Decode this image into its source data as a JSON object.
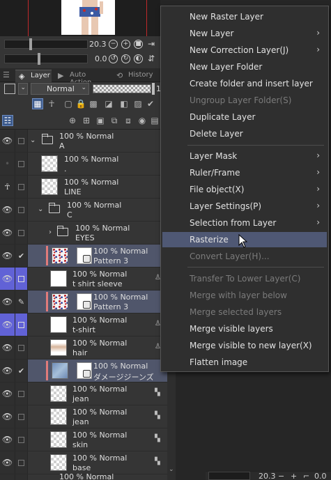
{
  "navigator": {
    "zoom_value": "20.3",
    "rotation_value": "0.0"
  },
  "tabs": [
    {
      "label": "Layer",
      "icon": "layers-icon",
      "active": true
    },
    {
      "label": "Auto Action",
      "icon": "auto-action-icon",
      "active": false
    },
    {
      "label": "History",
      "icon": "history-icon",
      "active": false
    }
  ],
  "blend_mode": {
    "selected": "Normal"
  },
  "opacity_value": "10",
  "layers": [
    {
      "pct": "100 %",
      "mode": "Normal",
      "name": "A",
      "type": "folder",
      "expanded": true,
      "indent": 0
    },
    {
      "pct": "100 %",
      "mode": "Normal",
      "name": ".",
      "type": "raster",
      "indent": 1
    },
    {
      "pct": "100 %",
      "mode": "Normal",
      "name": "LINE",
      "type": "raster",
      "indent": 1
    },
    {
      "pct": "100 %",
      "mode": "Normal",
      "name": "C",
      "type": "folder",
      "expanded": true,
      "indent": 1
    },
    {
      "pct": "100 %",
      "mode": "Normal",
      "name": "EYES",
      "type": "folder",
      "expanded": false,
      "indent": 2
    },
    {
      "pct": "100 %",
      "mode": "Normal",
      "name": "Pattern 3",
      "type": "pattern",
      "indent": 2
    },
    {
      "pct": "100 %",
      "mode": "Normal",
      "name": "t shirt sleeve",
      "type": "raster",
      "indent": 2
    },
    {
      "pct": "100 %",
      "mode": "Normal",
      "name": "Pattern 3",
      "type": "pattern",
      "indent": 2
    },
    {
      "pct": "100 %",
      "mode": "Normal",
      "name": "t-shirt",
      "type": "raster",
      "indent": 2
    },
    {
      "pct": "100 %",
      "mode": "Normal",
      "name": "hair",
      "type": "raster",
      "indent": 2
    },
    {
      "pct": "100 %",
      "mode": "Normal",
      "name": "ダメージジーンズ",
      "type": "denim",
      "indent": 2
    },
    {
      "pct": "100 %",
      "mode": "Normal",
      "name": "jean",
      "type": "raster",
      "indent": 2
    },
    {
      "pct": "100 %",
      "mode": "Normal",
      "name": "jean",
      "type": "raster",
      "indent": 2
    },
    {
      "pct": "100 %",
      "mode": "Normal",
      "name": "skin",
      "type": "raster",
      "indent": 2
    },
    {
      "pct": "100 %",
      "mode": "Normal",
      "name": "base",
      "type": "raster",
      "indent": 2
    },
    {
      "pct": "100 %",
      "mode": "Normal",
      "name": "",
      "type": "raster",
      "indent": 1
    }
  ],
  "context_menu": {
    "items": [
      {
        "label": "New Raster Layer",
        "submenu": false,
        "enabled": true
      },
      {
        "label": "New Layer",
        "submenu": true,
        "enabled": true
      },
      {
        "label": "New Correction Layer(J)",
        "submenu": true,
        "enabled": true
      },
      {
        "label": "New Layer Folder",
        "submenu": false,
        "enabled": true
      },
      {
        "label": "Create folder and insert layer",
        "submenu": false,
        "enabled": true
      },
      {
        "label": "Ungroup Layer Folder(S)",
        "submenu": false,
        "enabled": false
      },
      {
        "label": "Duplicate Layer",
        "submenu": false,
        "enabled": true
      },
      {
        "label": "Delete Layer",
        "submenu": false,
        "enabled": true
      },
      {
        "label": "Layer Mask",
        "submenu": true,
        "enabled": true
      },
      {
        "label": "Ruler/Frame",
        "submenu": true,
        "enabled": true
      },
      {
        "label": "File object(X)",
        "submenu": true,
        "enabled": true
      },
      {
        "label": "Layer Settings(P)",
        "submenu": true,
        "enabled": true
      },
      {
        "label": "Selection from Layer",
        "submenu": true,
        "enabled": true
      },
      {
        "label": "Rasterize",
        "submenu": false,
        "enabled": true,
        "hover": true
      },
      {
        "label": "Convert Layer(H)...",
        "submenu": false,
        "enabled": false
      },
      {
        "label": "Transfer To Lower Layer(C)",
        "submenu": false,
        "enabled": false
      },
      {
        "label": "Merge with layer below",
        "submenu": false,
        "enabled": false
      },
      {
        "label": "Merge selected layers",
        "submenu": false,
        "enabled": false
      },
      {
        "label": "Merge visible layers",
        "submenu": false,
        "enabled": true
      },
      {
        "label": "Merge visible to new layer(X)",
        "submenu": false,
        "enabled": true
      },
      {
        "label": "Flatten image",
        "submenu": false,
        "enabled": true
      }
    ],
    "submenu_arrow": "›"
  },
  "status_bar": {
    "zoom": "20.3",
    "rotation": "0.0"
  }
}
